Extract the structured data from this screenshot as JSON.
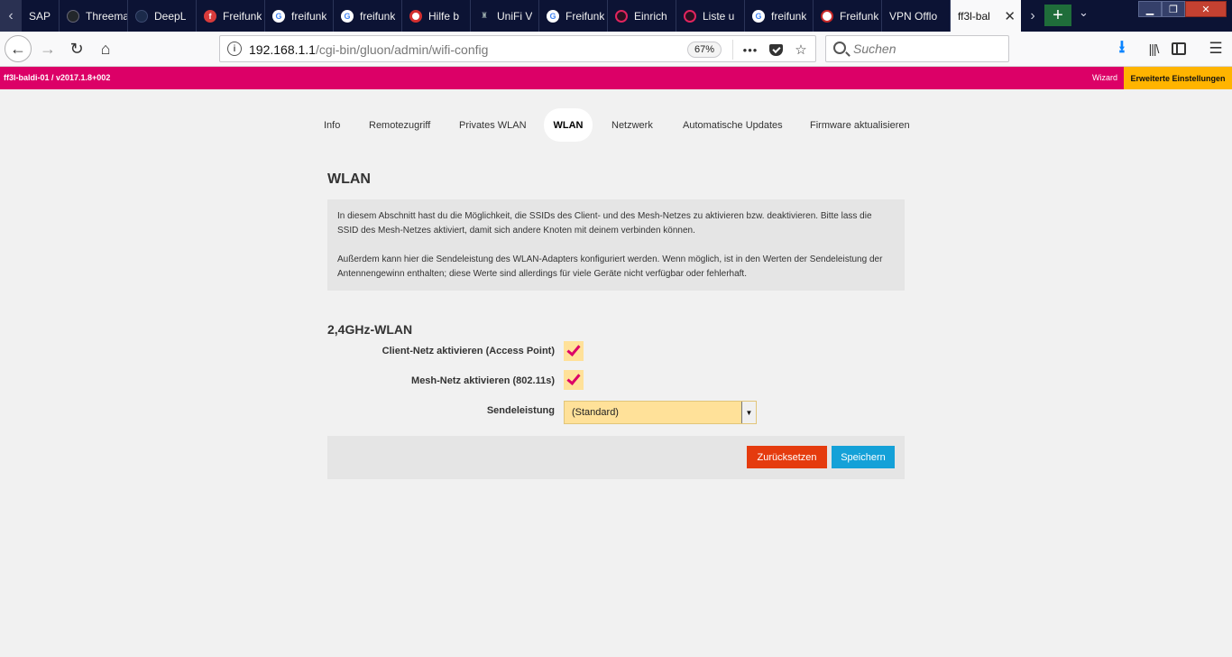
{
  "browser": {
    "tabs": [
      {
        "label": "SAP",
        "favicon": "sap-icon"
      },
      {
        "label": "Threema",
        "favicon": "github-icon"
      },
      {
        "label": "DeepL",
        "favicon": "deepl-icon"
      },
      {
        "label": "Freifunk",
        "favicon": "freifunk-icon"
      },
      {
        "label": "freifunk",
        "favicon": "google-icon"
      },
      {
        "label": "freifunk",
        "favicon": "google-icon"
      },
      {
        "label": "Hilfe b",
        "favicon": "help-icon"
      },
      {
        "label": "UniFi V",
        "favicon": "unifi-icon"
      },
      {
        "label": "Freifunk",
        "favicon": "google-icon"
      },
      {
        "label": "Einrich",
        "favicon": "freifunk-pink-icon"
      },
      {
        "label": "Liste u",
        "favicon": "freifunk-pink-icon"
      },
      {
        "label": "freifunk",
        "favicon": "google-icon"
      },
      {
        "label": "Freifunk",
        "favicon": "shield-icon"
      },
      {
        "label": "VPN Offlo",
        "favicon": ""
      }
    ],
    "active_tab": {
      "label": "ff3l-bal",
      "favicon": ""
    },
    "url": {
      "host": "192.168.1.1",
      "path": "/cgi-bin/gluon/admin/wifi-config"
    },
    "zoom": "67%",
    "search_placeholder": "Suchen"
  },
  "gluon": {
    "hostname": "ff3l-baldi-01 / v2017.1.8+002",
    "wizard_label": "Wizard",
    "advanced_label": "Erweiterte Einstellungen",
    "menu": [
      {
        "label": "Info"
      },
      {
        "label": "Remotezugriff"
      },
      {
        "label": "Privates WLAN"
      },
      {
        "label": "WLAN"
      },
      {
        "label": "Netzwerk"
      },
      {
        "label": "Automatische Updates"
      },
      {
        "label": "Firmware aktualisieren"
      }
    ],
    "active_menu": "WLAN"
  },
  "page": {
    "title": "WLAN",
    "description_1": "In diesem Abschnitt hast du die Möglichkeit, die SSIDs des Client- und des Mesh-Netzes zu aktivieren bzw. deaktivieren. Bitte lass die SSID des Mesh-Netzes aktiviert, damit sich andere Knoten mit deinem verbinden können.",
    "description_2": "Außerdem kann hier die Sendeleistung des WLAN-Adapters konfiguriert werden. Wenn möglich, ist in den Werten der Sendeleistung der Antennengewinn enthalten; diese Werte sind allerdings für viele Geräte nicht verfügbar oder fehlerhaft.",
    "band_title": "2,4GHz-WLAN",
    "client_label": "Client-Netz aktivieren (Access Point)",
    "client_enabled": true,
    "mesh_label": "Mesh-Netz aktivieren (802.11s)",
    "mesh_enabled": true,
    "txpower_label": "Sendeleistung",
    "txpower_value": "(Standard)",
    "reset_label": "Zurücksetzen",
    "save_label": "Speichern"
  },
  "colors": {
    "header_bg": "#dc0067",
    "advanced_bg": "#ffb400",
    "field_bg": "#ffe199",
    "reset_bg": "#e53b0e",
    "save_bg": "#14a1d8"
  }
}
